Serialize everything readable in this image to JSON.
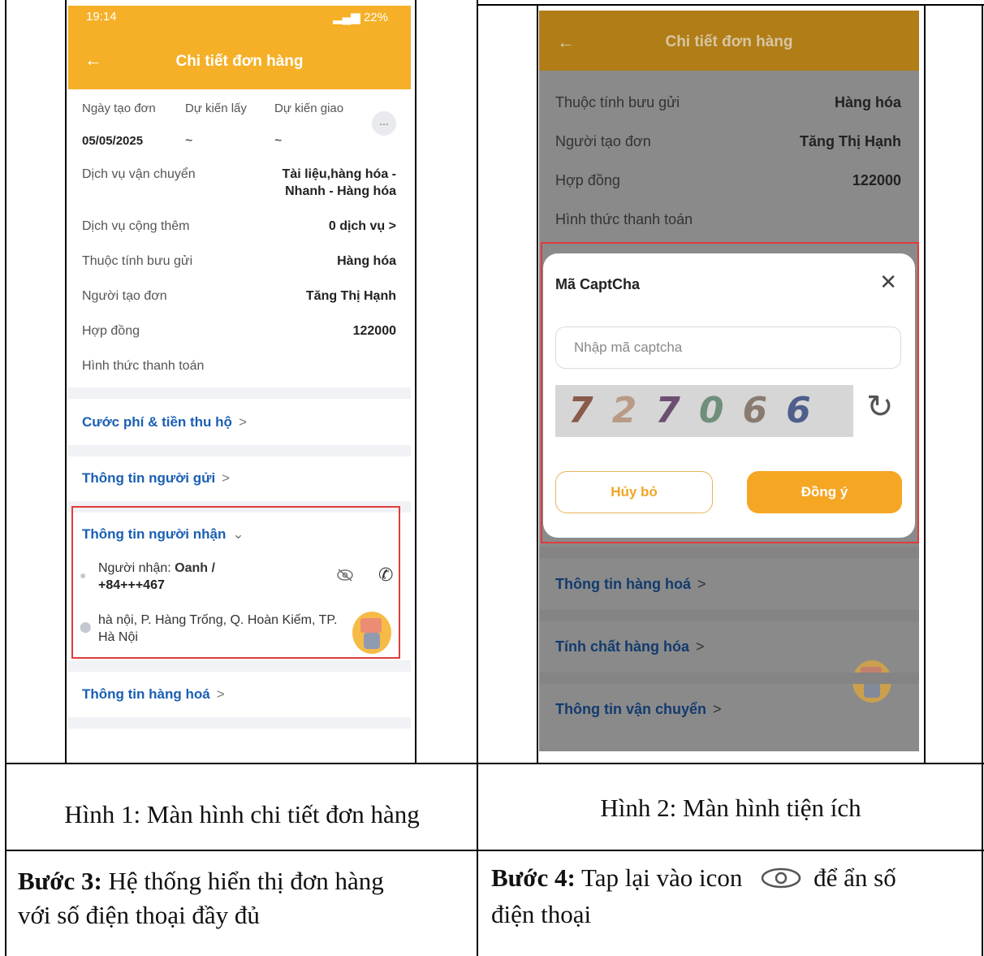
{
  "screen1": {
    "status_time": "19:14",
    "status_battery": "22%",
    "app_title": "Chi tiết đơn hàng",
    "date_headers": [
      "Ngày tạo đơn",
      "Dự kiến lấy",
      "Dự kiến giao"
    ],
    "date_values": [
      "05/05/2025",
      "~",
      "~"
    ],
    "more_label": "...",
    "rows": [
      {
        "label": "Dịch vụ vận chuyển",
        "value_line1": "Tài liệu,hàng hóa -",
        "value_line2": "Nhanh - Hàng hóa"
      },
      {
        "label": "Dịch vụ cộng thêm",
        "value": "0 dịch vụ",
        "value_suffix": ">"
      },
      {
        "label": "Thuộc tính bưu gửi",
        "value": "Hàng hóa"
      },
      {
        "label": "Người tạo đơn",
        "value": "Tăng Thị Hạnh"
      },
      {
        "label": "Hợp đồng",
        "value": "122000"
      },
      {
        "label": "Hình thức thanh toán"
      }
    ],
    "sections": [
      "Cước phí & tiền thu hộ",
      "Thông tin người gửi",
      "Thông tin người nhận",
      "Thông tin hàng hoá"
    ],
    "recipient_label": "Người nhận: ",
    "recipient_name": "Oanh /",
    "recipient_phone": "+84+++467",
    "address_line1": "hà nội, P. Hàng Trống, Q. Hoàn Kiếm, TP.",
    "address_line2": "Hà Nội"
  },
  "screen2": {
    "app_title": "Chi tiết đơn hàng",
    "rows": [
      {
        "label": "Thuộc tính bưu gửi",
        "value": "Hàng hóa"
      },
      {
        "label": "Người tạo đơn",
        "value": "Tăng Thị Hạnh"
      },
      {
        "label": "Hợp đồng",
        "value": "122000"
      },
      {
        "label": "Hình thức thanh toán"
      }
    ],
    "dialog": {
      "title": "Mã CaptCha",
      "placeholder": "Nhập mã captcha",
      "captcha_digits": [
        "7",
        "2",
        "7",
        "0",
        "6",
        "6"
      ],
      "cancel_label": "Hủy bỏ",
      "confirm_label": "Đồng ý"
    },
    "sections": [
      "Thông tin hàng hoá",
      "Tính chất hàng hóa",
      "Thông tin vận chuyển"
    ]
  },
  "captions": {
    "fig1": "Hình 1: Màn hình chi tiết đơn hàng",
    "fig2": "Hình 2: Màn hình tiện ích"
  },
  "steps": {
    "step3_bold": "Bước 3:",
    "step3_line1": " Hệ thống hiển thị đơn hàng",
    "step3_line2": "với số điện thoại đầy đủ",
    "step4_bold": "Bước 4:",
    "step4_line1a": " Tap lại vào icon",
    "step4_line1b": "để ẩn số",
    "step4_line2": "điện thoại"
  }
}
